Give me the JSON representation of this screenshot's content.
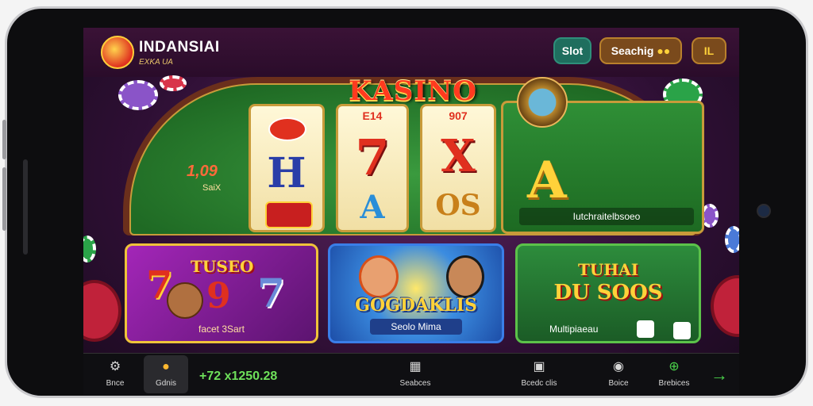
{
  "header": {
    "app_name": "INDANSIAI",
    "app_subtitle": "EXKA UA",
    "slot_label": "Slot",
    "search_label": "Seachig",
    "user_label": "IL"
  },
  "table": {
    "title": "KASINO",
    "side_number": "1,09",
    "side_sub": "SaiX",
    "reels": [
      {
        "top": "",
        "symbol": "H"
      },
      {
        "top": "E14",
        "symbol": "7"
      },
      {
        "top": "907",
        "symbol": "X"
      }
    ],
    "reel_lower": [
      "",
      "A",
      "OS"
    ],
    "feature_symbol": "A",
    "feature_caption": "Iutchraitelbsoeo"
  },
  "cards": [
    {
      "title": "TUSEO",
      "caption": "facet 3Sart"
    },
    {
      "title": "GOGDAKLIS",
      "caption": "Seolo Mima"
    },
    {
      "title": "DU SOOS",
      "title_top": "TUHAI",
      "caption": "Multipiaeau"
    }
  ],
  "nav": {
    "items": [
      {
        "label": "Bnce",
        "icon": "gear-icon"
      },
      {
        "label": "Gdnis",
        "icon": "coin-icon"
      },
      {
        "label": "Seabces",
        "icon": "calculator-icon"
      },
      {
        "label": "Bcedc clis",
        "icon": "store-icon"
      },
      {
        "label": "Boice",
        "icon": "dice-icon"
      },
      {
        "label": "Brebices",
        "icon": "search-icon"
      }
    ],
    "balance": "+72 x1250.28"
  },
  "colors": {
    "accent": "#ff3a1f",
    "felt": "#2f8f36",
    "balance": "#6ee05a"
  }
}
